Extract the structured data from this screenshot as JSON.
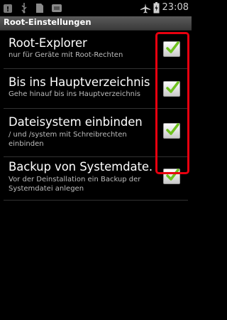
{
  "status_bar": {
    "time": "23:08",
    "icons": [
      "notification-icon",
      "usb-icon",
      "sd-card-icon",
      "usb-debug-icon",
      "airplane-mode-icon",
      "battery-charging-icon"
    ]
  },
  "title_bar": {
    "title": "Root-Einstellungen"
  },
  "preferences": [
    {
      "title": "Root-Explorer",
      "summary": "nur für Geräte mit Root-Rechten",
      "checked": true
    },
    {
      "title": "Bis ins Hauptverzeichnis",
      "summary": "Gehe hinauf bis ins Hauptverzeichnis",
      "checked": true
    },
    {
      "title": "Dateisystem einbinden",
      "summary": " / und /system mit Schreibrechten einbinden",
      "checked": true
    },
    {
      "title": "Backup von Systemdate.",
      "summary": "Vor der Deinstallation ein Backup der Systemdatei anlegen",
      "checked": true
    }
  ],
  "highlight_color": "#e8000f",
  "check_color": "#6ec21e"
}
